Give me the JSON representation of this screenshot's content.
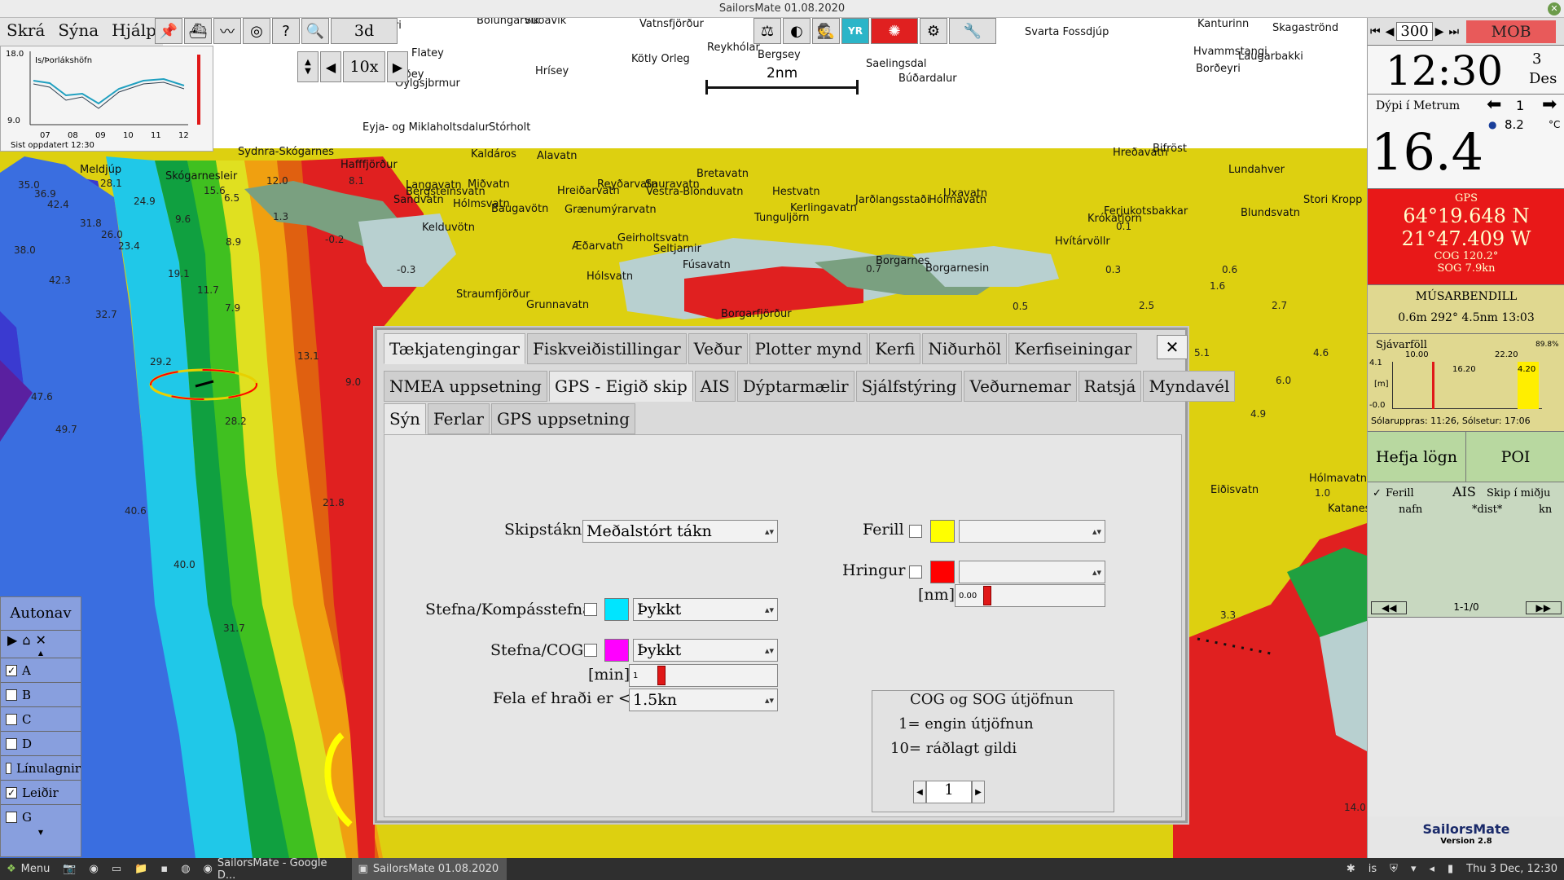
{
  "window": {
    "title": "SailorsMate 01.08.2020",
    "close_label": "x"
  },
  "menu": {
    "items": [
      "Skrá",
      "Sýna",
      "Hjálp"
    ]
  },
  "toolbar": {
    "view_3d": "3d"
  },
  "zoom": {
    "value": "10x"
  },
  "scale": {
    "label": "2nm"
  },
  "depth_graph": {
    "location": "Is/Þorlákshöfn",
    "y_top": "18.0",
    "y_bottom": "9.0",
    "hours": [
      "07",
      "08",
      "09",
      "10",
      "11",
      "12"
    ],
    "updated": "Sist oppdatert 12:30"
  },
  "map_labels": [
    "geyri",
    "Bolungarvík",
    "Súðavík",
    "Vatnsfjörður",
    "Svarta Fossdjúp",
    "Kanturinn",
    "Skagaströnd",
    "Hvammstangi",
    "Laugarbakki",
    "Borðeyri",
    "Flatey",
    "Reykhólar",
    "Bergsey",
    "Saelingsdal",
    "Búðardalur",
    "Hrísey",
    "Kötly Orleg",
    "Jaðey",
    "Öylgsjbrmur",
    "Eyja- og Miklaholtsdalur",
    "Stórholt",
    "Sydnra-Skógarnes",
    "Hafffjörður",
    "Meldjúp",
    "Skógarnesleir",
    "Kaldáros",
    "Alavatn",
    "Bifröst",
    "Hreðavatn",
    "Lundahver",
    "Miðvatn",
    "Langavatn",
    "Reyðarvatn",
    "Sauravatn",
    "Bretavatn",
    "Hreiðarvatn",
    "Vestra-Blönduvatn",
    "Hestvatn",
    "Jarðlangsstaði",
    "Uxavatn",
    "Hólmavatn",
    "Ferjukotsbakkar",
    "Stori Kropp",
    "Blundsvatn",
    "Bergsteinsvatn",
    "Sandvatn",
    "Hólmsvatn",
    "Baugavötn",
    "Grænumýrarvatn",
    "Kerlingavatn",
    "Tunguljörn",
    "Krókatjörn",
    "Hvítárvöllr",
    "Kelduvötn",
    "Geirholtsvatn",
    "Æðarvatn",
    "Seltjarnir",
    "Fúsavatn",
    "Borgarnes",
    "Borgarnesin",
    "Hólsvatn",
    "Straumfjörður",
    "Grunnavatn",
    "Borgarfjörður",
    "Hólmavatn",
    "Eiðisvatn",
    "Katanesstjörn"
  ],
  "depths": [
    "35.0",
    "28.1",
    "36.9",
    "24.9",
    "42.4",
    "15.6",
    "12.0",
    "8.1",
    "6.5",
    "26.0",
    "31.8",
    "23.4",
    "38.0",
    "9.6",
    "8.9",
    "42.3",
    "19.1",
    "11.7",
    "7.9",
    "32.7",
    "29.2",
    "13.1",
    "47.6",
    "9.0",
    "49.7",
    "28.2",
    "21.8",
    "40.6",
    "40.0",
    "31.7",
    "14.0",
    "1.3",
    "-0.2",
    "-0.3",
    "0.7",
    "0.5",
    "2.5",
    "2.7",
    "1.6",
    "0.6",
    "0.3",
    "0.1",
    "5.1",
    "4.6",
    "6.0",
    "4.9",
    "3.3",
    "1.0"
  ],
  "dialog": {
    "close": "✕",
    "tabs_row1": [
      "Tækjatengingar",
      "Fiskveiðistillingar",
      "Veður",
      "Plotter mynd",
      "Kerfi",
      "Niðurhöl",
      "Kerfiseiningar"
    ],
    "tabs_row2": [
      "NMEA uppsetning",
      "GPS - Eigið skip",
      "AIS",
      "Dýptarmælir",
      "Sjálfstýring",
      "Veðurnemar",
      "Ratsjá",
      "Myndavél"
    ],
    "tabs_row3": [
      "Sýn",
      "Ferlar",
      "GPS uppsetning"
    ],
    "ship_symbol_label": "Skipstákn",
    "ship_symbol_value": "Meðalstórt tákn",
    "heading_label": "Stefna/Kompásstefna",
    "heading_value": "Þykkt",
    "cog_label": "Stefna/COG",
    "cog_value": "Þykkt",
    "min_label": "[min]",
    "min_value": "1",
    "hide_label": "Fela ef hraði er <",
    "hide_value": "1.5kn",
    "track_label": "Ferill",
    "track_value": "",
    "ring_label": "Hringur",
    "ring_value": "",
    "nm_label": "[nm]",
    "nm_value": "0.00",
    "smoothing_title": "COG og SOG útjöfnun",
    "smoothing_line1": "1= engin útjöfnun",
    "smoothing_line2": "10= ráðlagt gildi",
    "smoothing_value": "1",
    "colors": {
      "heading": "#00e5ff",
      "cog": "#ff00ff",
      "track": "#ffff00",
      "ring": "#ff0000"
    }
  },
  "right_panel": {
    "zoom_value": "300",
    "mob": "MOB",
    "time": "12:30",
    "day": "3",
    "month": "Des",
    "depth_label": "Dýpi í Metrum",
    "depth_count": "1",
    "temperature": "8.2",
    "temp_unit": "°C",
    "depth_value": "16.4",
    "gps_title": "GPS",
    "lat": "64°19.648 N",
    "lon": "21°47.409 W",
    "cog": "COG 120.2°",
    "sog": "SOG 7.9kn",
    "waypoint_title": "MÚSARBENDILL",
    "waypoint_line": "0.6m  292°  4.5nm  13:03",
    "tide_title": "Sjávarföll",
    "tide_times": [
      "10.00",
      "16.20",
      "22.20"
    ],
    "tide_axis": [
      "4.1",
      "-0.0"
    ],
    "tide_unit": "[m]",
    "tide_pct": "89.8%",
    "tide_level": "4.20",
    "sun_line": "Sólaruppras: 11:26, Sólsetur: 17:06",
    "start_log": "Hefja lögn",
    "poi": "POI",
    "track_check": "Ferill",
    "ais": "AIS",
    "center_check": "Skip í miðju",
    "col_name": "nafn",
    "col_dist": "*dist*",
    "col_kn": "kn",
    "ais_page": "1-1/0",
    "brand": "SailorsMate",
    "version": "Version 2.8"
  },
  "autonav": {
    "title": "Autonav",
    "items": [
      {
        "label": "A",
        "checked": true
      },
      {
        "label": "B",
        "checked": false
      },
      {
        "label": "C",
        "checked": false
      },
      {
        "label": "D",
        "checked": false
      },
      {
        "label": "Línulagnir",
        "checked": false
      },
      {
        "label": "Leiðir",
        "checked": true
      },
      {
        "label": "G",
        "checked": false
      }
    ]
  },
  "taskbar": {
    "menu": "Menu",
    "apps": [
      "SailorsMate - Google D...",
      "SailorsMate 01.08.2020"
    ],
    "lang": "is",
    "clock": "Thu 3 Dec, 12:30"
  }
}
